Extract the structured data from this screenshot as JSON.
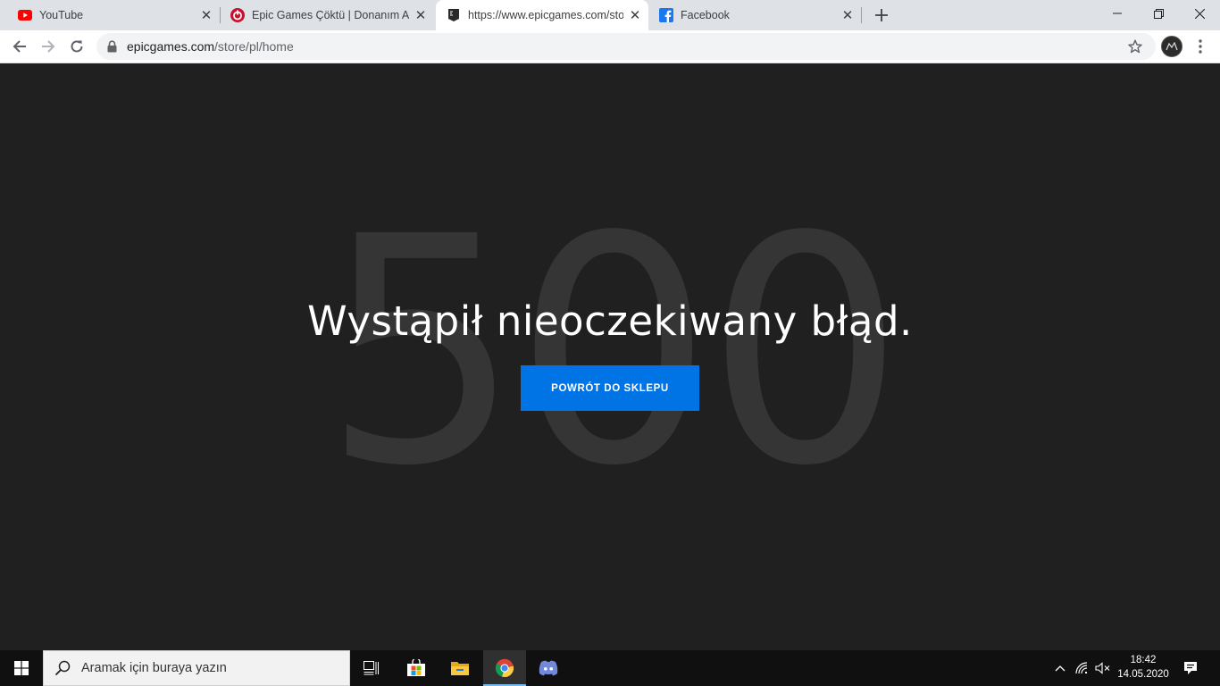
{
  "browser": {
    "tabs": [
      {
        "title": "YouTube",
        "favicon": "youtube-icon"
      },
      {
        "title": "Epic Games Çöktü | Donanım Arşivi",
        "favicon": "donanim-arsivi-icon"
      },
      {
        "title": "https://www.epicgames.com/store/pl/home",
        "favicon": "epic-games-icon",
        "active": true
      },
      {
        "title": "Facebook",
        "favicon": "facebook-icon"
      }
    ],
    "url_host": "epicgames.com",
    "url_path": "/store/pl/home"
  },
  "page": {
    "error_code": "500",
    "message": "Wystąpił nieoczekiwany błąd.",
    "button_label": "POWRÓT DO SKLEPU",
    "colors": {
      "background": "#202020",
      "error_code": "#353535",
      "button": "#0074e4"
    }
  },
  "taskbar": {
    "search_placeholder": "Aramak için buraya yazın",
    "apps": [
      "task-view-icon",
      "microsoft-store-icon",
      "file-explorer-icon",
      "chrome-icon",
      "discord-icon"
    ],
    "active_app": "chrome-icon",
    "time": "18:42",
    "date": "14.05.2020"
  }
}
